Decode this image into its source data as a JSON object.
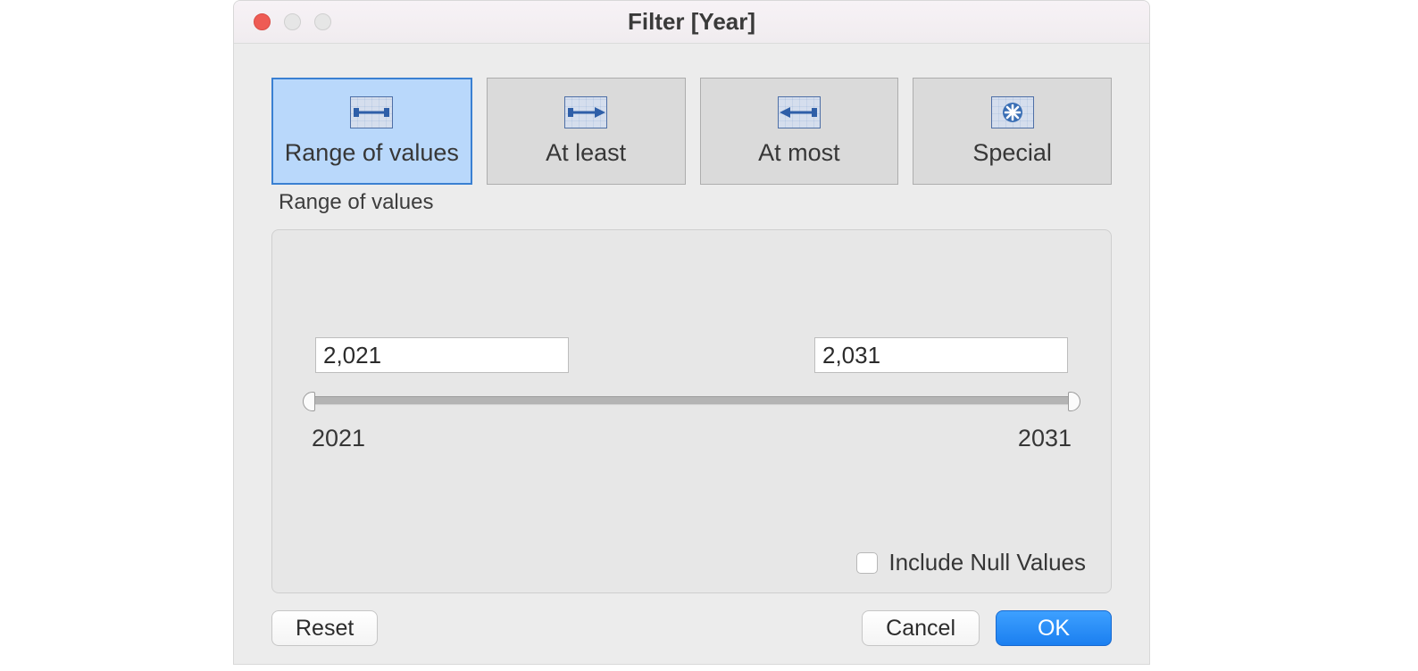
{
  "window": {
    "title": "Filter [Year]"
  },
  "tabs": {
    "range": {
      "label": "Range of values"
    },
    "atleast": {
      "label": "At least"
    },
    "atmost": {
      "label": "At most"
    },
    "special": {
      "label": "Special"
    },
    "selected_caption": "Range of values"
  },
  "range": {
    "min_value": "2,021",
    "max_value": "2,031",
    "scale_min": "2021",
    "scale_max": "2031"
  },
  "options": {
    "include_null_label": "Include Null Values",
    "include_null_checked": false
  },
  "buttons": {
    "reset": "Reset",
    "cancel": "Cancel",
    "ok": "OK"
  }
}
